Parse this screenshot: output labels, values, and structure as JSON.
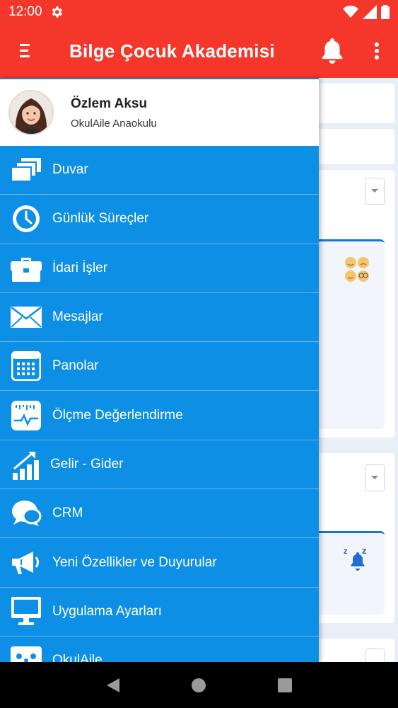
{
  "status_bar": {
    "time": "12:00",
    "icons": [
      "settings-icon",
      "wifi-icon",
      "signal-icon",
      "battery-icon"
    ]
  },
  "app_bar": {
    "title": "Bilge Çocuk Akademisi",
    "icons": [
      "menu-icon",
      "bell-icon",
      "more-vert-icon"
    ]
  },
  "drawer": {
    "user": {
      "name": "Özlem Aksu",
      "school": "OkulAile Anaokulu"
    },
    "items": [
      {
        "label": "Duvar",
        "icon": "wall-icon"
      },
      {
        "label": "Günlük Süreçler",
        "icon": "clock-icon"
      },
      {
        "label": "İdari İşler",
        "icon": "briefcase-icon"
      },
      {
        "label": "Mesajlar",
        "icon": "envelope-icon"
      },
      {
        "label": "Panolar",
        "icon": "calendar-board-icon"
      },
      {
        "label": "Ölçme Değerlendirme",
        "icon": "chart-monitor-icon"
      },
      {
        "label": "Gelir - Gider",
        "icon": "growth-chart-icon"
      },
      {
        "label": "CRM",
        "icon": "chat-bubbles-icon"
      },
      {
        "label": "Yeni Özellikler ve Duyurular",
        "icon": "megaphone-icon"
      },
      {
        "label": "Uygulama Ayarları",
        "icon": "desktop-icon"
      },
      {
        "label": "OkulAile",
        "icon": "family-icon"
      }
    ]
  },
  "colors": {
    "app_bar": "#f5372b",
    "drawer_menu": "#0e8fe6",
    "nav_bar": "#000000"
  }
}
